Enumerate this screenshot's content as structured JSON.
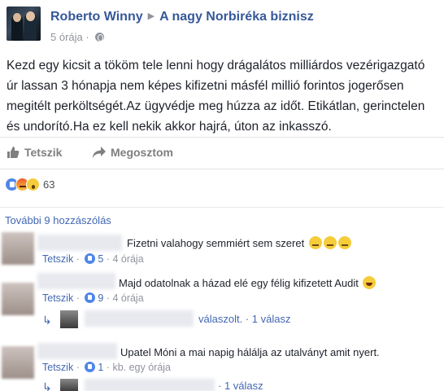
{
  "post": {
    "author": "Roberto Winny",
    "target_group": "A nagy Norbiréka biznisz",
    "time": "5 órája",
    "privacy_icon": "globe-icon",
    "text": "Kezd egy kicsit a tököm tele lenni hogy drágalátos milliárdos vezérigazgató úr lassan 3 hónapja nem képes kifizetni másfél millió forintos jogerősen megitélt perköltségét.Az ügyvédje meg húzza az időt. Etikátlan, gerinctelen és undorító.Ha ez kell nekik akkor hajrá, úton az inkasszó."
  },
  "actions": {
    "like_label": "Tetszik",
    "share_label": "Megosztom"
  },
  "reactions": {
    "types": [
      "like",
      "angry",
      "wow"
    ],
    "count": "63"
  },
  "comments_section": {
    "more_label": "További 9 hozzászólás",
    "comments": [
      {
        "text": "Fizetni valahogy semmiért sem szeret",
        "like_label": "Tetszik",
        "likes": "5",
        "time": "4 órája"
      },
      {
        "text": "Majd odatolnak a házad elé egy félig kifizetett Audit",
        "like_label": "Tetszik",
        "likes": "9",
        "time": "4 órája",
        "reply_summary": "válaszolt.",
        "reply_count": "1 válasz"
      },
      {
        "text": "Upatel Móni a mai napig hálálja az utalványt amit nyert.",
        "like_label": "Tetszik",
        "likes": "1",
        "time": "kb. egy órája",
        "reply_count": "1 válasz"
      }
    ],
    "separator": "·"
  },
  "colors": {
    "link": "#365899",
    "meta": "#90949c",
    "like_blue": "#4f86e8"
  }
}
